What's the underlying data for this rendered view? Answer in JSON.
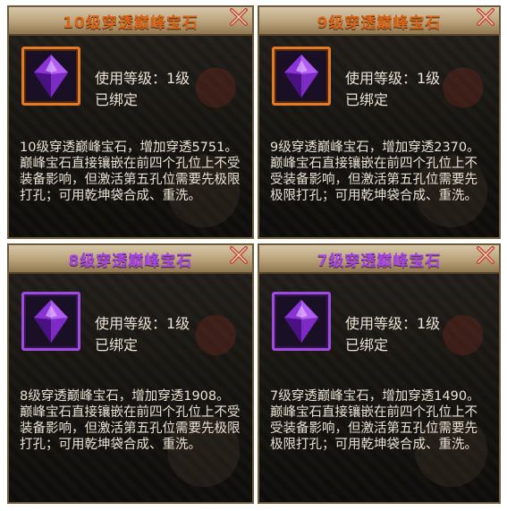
{
  "cards": [
    {
      "title": "10级穿透巅峰宝石",
      "level": "使用等级：1级",
      "bound": "已绑定",
      "desc1": "10级穿透巅峰宝石，增加穿透5751。",
      "desc2": "巅峰宝石直接镶嵌在前四个孔位上不受装备影响，但激活第五孔位需要先极限打孔；可用乾坤袋合成、重洗。",
      "title_color": "#d9661a",
      "frame": "orange"
    },
    {
      "title": "9级穿透巅峰宝石",
      "level": "使用等级：1级",
      "bound": "已绑定",
      "desc1": "9级穿透巅峰宝石，增加穿透2370。",
      "desc2": "巅峰宝石直接镶嵌在前四个孔位上不受装备影响，但激活第五孔位需要先极限打孔；可用乾坤袋合成、重洗。",
      "title_color": "#d9661a",
      "frame": "orange"
    },
    {
      "title": "8级穿透巅峰宝石",
      "level": "使用等级：1级",
      "bound": "已绑定",
      "desc1": "8级穿透巅峰宝石，增加穿透1908。",
      "desc2": "巅峰宝石直接镶嵌在前四个孔位上不受装备影响，但激活第五孔位需要先极限打孔；可用乾坤袋合成、重洗。",
      "title_color": "#a847e6",
      "frame": "purple"
    },
    {
      "title": "7级穿透巅峰宝石",
      "level": "使用等级：1级",
      "bound": "已绑定",
      "desc1": "7级穿透巅峰宝石，增加穿透1490。",
      "desc2": "巅峰宝石直接镶嵌在前四个孔位上不受装备影响，但激活第五孔位需要先极限打孔；可用乾坤袋合成、重洗。",
      "title_color": "#a847e6",
      "frame": "purple"
    }
  ],
  "icons": {
    "gem": "purple-gem-icon",
    "close": "close-icon"
  }
}
